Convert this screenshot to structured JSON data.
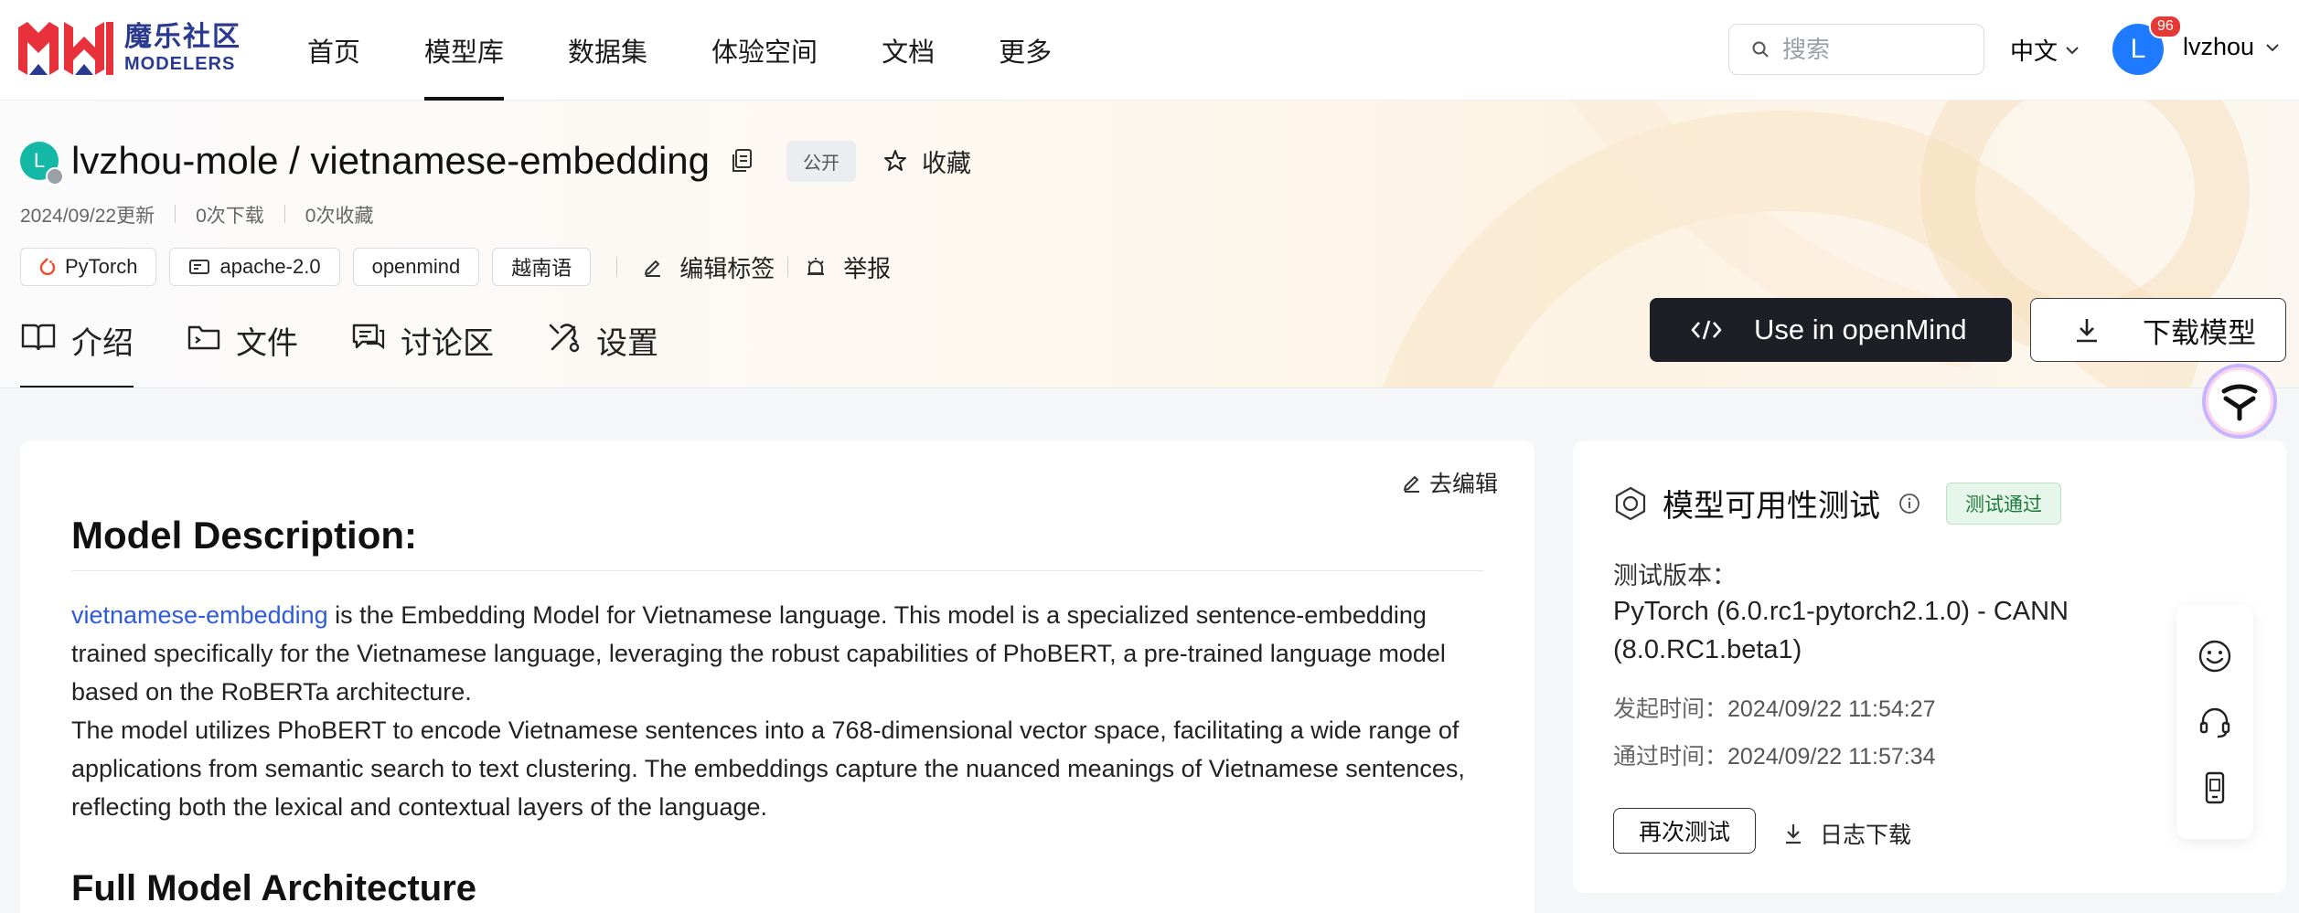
{
  "nav": {
    "logo_cn": "魔乐社区",
    "logo_en": "MODELERS",
    "links": [
      "首页",
      "模型库",
      "数据集",
      "体验空间",
      "文档",
      "更多"
    ],
    "active_index": 1,
    "search_placeholder": "搜索",
    "language": "中文",
    "avatar_letter": "L",
    "notification_count": "96",
    "username": "lvzhou"
  },
  "repo": {
    "avatar_letter": "L",
    "name": "lvzhou-mole / vietnamese-embedding",
    "visibility": "公开",
    "favorite_label": "收藏",
    "updated": "2024/09/22更新",
    "downloads": "0次下载",
    "favorites": "0次收藏",
    "tags": [
      "PyTorch",
      "apache-2.0",
      "openmind",
      "越南语"
    ],
    "edit_tags_label": "编辑标签",
    "report_label": "举报",
    "tabs": [
      "介绍",
      "文件",
      "讨论区",
      "设置"
    ],
    "active_tab": 0,
    "use_button": "Use in openMind",
    "download_button": "下载模型"
  },
  "content": {
    "edit_label": "去编辑",
    "heading": "Model Description:",
    "link_text": "vietnamese-embedding",
    "para1_rest": " is the Embedding Model for Vietnamese language. This model is a specialized sentence-embedding trained specifically for the Vietnamese language, leveraging the robust capabilities of PhoBERT, a pre-trained language model based on the RoBERTa architecture.",
    "para2": "The model utilizes PhoBERT to encode Vietnamese sentences into a 768-dimensional vector space, facilitating a wide range of applications from semantic search to text clustering. The embeddings capture the nuanced meanings of Vietnamese sentences, reflecting both the lexical and contextual layers of the language.",
    "heading2": "Full Model Architecture"
  },
  "side": {
    "title": "模型可用性测试",
    "status": "测试通过",
    "version_label": "测试版本：",
    "version_value": "PyTorch (6.0.rc1-pytorch2.1.0) - CANN (8.0.RC1.beta1)",
    "start_label": "发起时间：",
    "start_value": "2024/09/22 11:54:27",
    "pass_label": "通过时间：",
    "pass_value": "2024/09/22 11:57:34",
    "retest_button": "再次测试",
    "log_download": "日志下载"
  },
  "colors": {
    "brand_red": "#e8313a",
    "brand_blue": "#2a3a8f",
    "link_blue": "#2f5bd8",
    "avatar_blue": "#1e7bff",
    "repo_avatar_teal": "#14b8a6",
    "status_green": "#1f7a3a"
  }
}
